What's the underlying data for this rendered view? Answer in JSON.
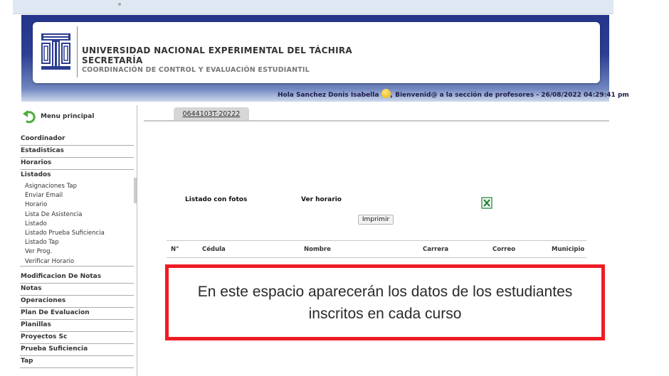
{
  "header": {
    "org_title": "UNIVERSIDAD NACIONAL EXPERIMENTAL DEL TÁCHIRA",
    "org_sub1": "SECRETARÍA",
    "org_sub2": "COORDINACIÓN DE CONTROL Y EVALUACIÓN ESTUDIANTIL",
    "greeting": "Hola Sanchez Donis Isabella",
    "welcome": ", Bienvenid@ a la sección de profesores - 26/08/2022 04:29:41 pm",
    "brand_color": "#2c3f93"
  },
  "sidebar": {
    "menu_principal": "Menu principal",
    "items": [
      "Coordinador",
      "Estadisticas",
      "Horarios",
      "Listados"
    ],
    "listados_sub": [
      "Asignaciones Tap",
      "Enviar Email",
      "Horario",
      "Lista De Asistencia",
      "Listado",
      "Listado Prueba Suficiencia",
      "Listado Tap",
      "Ver Prog.",
      "Verificar Horario"
    ],
    "items_after": [
      "Modificacion De Notas",
      "Notas",
      "Operaciones",
      "Plan De Evaluacion",
      "Planillas",
      "Proyectos Sc",
      "Prueba Suficiencia",
      "Tap"
    ]
  },
  "main": {
    "tab_label": "0644103T-20222",
    "option_fotos": "Listado con fotos",
    "option_horario": "Ver horario",
    "print_label": "Imprimir",
    "table_headers": [
      "N°",
      "Cédula",
      "Nombre",
      "Carrera",
      "Correo",
      "Municipio"
    ]
  },
  "note": {
    "text": "En este espacio aparecerán los datos de los estudiantes inscritos en cada curso",
    "border_color": "#ee1c24"
  }
}
